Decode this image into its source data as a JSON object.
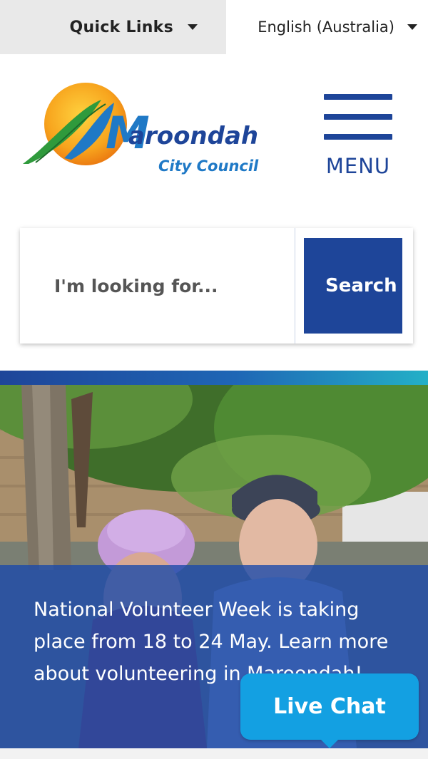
{
  "topbar": {
    "quick_links_label": "Quick Links",
    "language_label": "English (Australia)"
  },
  "header": {
    "logo_name_initial": "M",
    "logo_name_rest": "aroondah",
    "logo_subtitle": "City Council",
    "menu_label": "MENU"
  },
  "search": {
    "placeholder": "I'm looking for...",
    "button_label": "Search"
  },
  "hero": {
    "announcement": "National Volunteer Week is taking place from 18 to 24 May. Learn more about volunteering in Maroondah!"
  },
  "live_chat": {
    "label": "Live Chat"
  },
  "colors": {
    "brand_blue": "#1e4599",
    "topbar_grey": "#e9e9e9",
    "chat_blue": "#13a0e2",
    "logo_orange": "#f39a1e",
    "logo_green": "#2f9a3c"
  },
  "icons": [
    "dropdown-caret-icon",
    "hamburger-menu-icon",
    "chat-bubble-tail-icon"
  ]
}
